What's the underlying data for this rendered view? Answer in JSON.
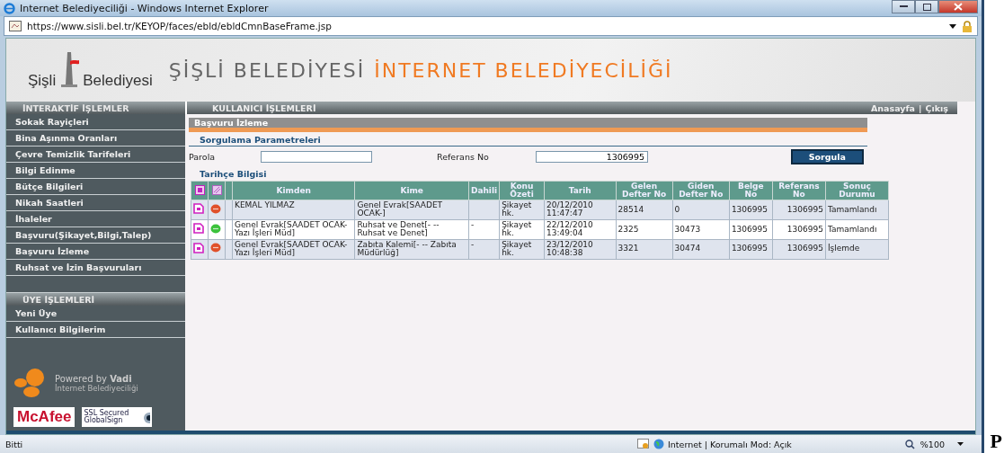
{
  "window": {
    "title": "Internet Belediyeciliği - Windows Internet Explorer"
  },
  "address_bar": {
    "url": "https://www.sisli.bel.tr/KEYOP/faces/ebld/ebldCmnBaseFrame.jsp"
  },
  "banner": {
    "logo_left": "Şişli",
    "logo_right": "Belediyesi",
    "title_part1": "ŞİŞLİ BELEDİYESİ",
    "title_part2": "İNTERNET BELEDİYECİLİĞİ"
  },
  "sidebar": {
    "sections": [
      {
        "title": "İNTERAKTİF İŞLEMLER",
        "items": [
          "Sokak Rayiçleri",
          "Bina Aşınma Oranları",
          "Çevre Temizlik Tarifeleri",
          "Bilgi Edinme",
          "Bütçe Bilgileri",
          "Nikah Saatleri",
          "İhaleler",
          "Başvuru(Şikayet,Bilgi,Talep)",
          "Başvuru İzleme",
          "Ruhsat ve İzin Başvuruları"
        ]
      },
      {
        "title": "ÜYE İŞLEMLERİ",
        "items": [
          "Yeni Üye",
          "Kullanıcı Bilgilerim"
        ]
      }
    ],
    "powered_by": "Powered by",
    "powered_brand": "Vadi",
    "powered_sub": "İnternet Belediyeciliği",
    "badge_mcafee": "McAfee",
    "badge_ssl": "SSL Secured GlobalSign"
  },
  "header": {
    "section": "KULLANICI İŞLEMLERİ",
    "links": [
      "Anasayfa",
      "Çıkış"
    ],
    "separator": "|"
  },
  "panel": {
    "title": "Başvuru İzleme",
    "query_title": "Sorgulama Parametreleri",
    "fields": [
      {
        "label": "Parola"
      },
      {
        "label": "Referans No",
        "value": "1306995"
      }
    ],
    "button": "Sorgula",
    "history_title": "Tarihçe Bilgisi"
  },
  "table": {
    "columns": [
      "Kimden",
      "Kime",
      "Dahili",
      "Konu Özeti",
      "Tarih",
      "Gelen Defter No",
      "Giden Defter No",
      "Belge No",
      "Referans No",
      "Sonuç Durumu"
    ],
    "rows": [
      {
        "color": "#e0502a",
        "cells": [
          "KEMAL YILMAZ",
          "Genel Evrak[SAADET OCAK-]",
          "",
          "Şikayet hk.",
          "20/12/2010 11:47:47",
          "28514",
          "0",
          "1306995",
          "1306995",
          "Tamamlandı"
        ]
      },
      {
        "color": "#3cc23c",
        "cells": [
          "Genel Evrak[SAADET OCAK-Yazı İşleri Müd]",
          "Ruhsat ve Denet[- -- Ruhsat ve Denet]",
          "-",
          "Şikayet hk.",
          "22/12/2010 13:49:04",
          "2325",
          "30473",
          "1306995",
          "1306995",
          "Tamamlandı"
        ]
      },
      {
        "color": "#e0502a",
        "cells": [
          "Genel Evrak[SAADET OCAK-Yazı İşleri Müd]",
          "Zabıta Kalemi[- -- Zabıta Müdürlüğ]",
          "-",
          "Şikayet hk.",
          "23/12/2010 10:48:38",
          "3321",
          "30474",
          "1306995",
          "1306995",
          "İşlemde"
        ]
      }
    ]
  },
  "status_bar": {
    "text": "Bitti",
    "zone": "Internet | Korumalı Mod: Açık",
    "zoom": "%100"
  },
  "edge_text": "P"
}
